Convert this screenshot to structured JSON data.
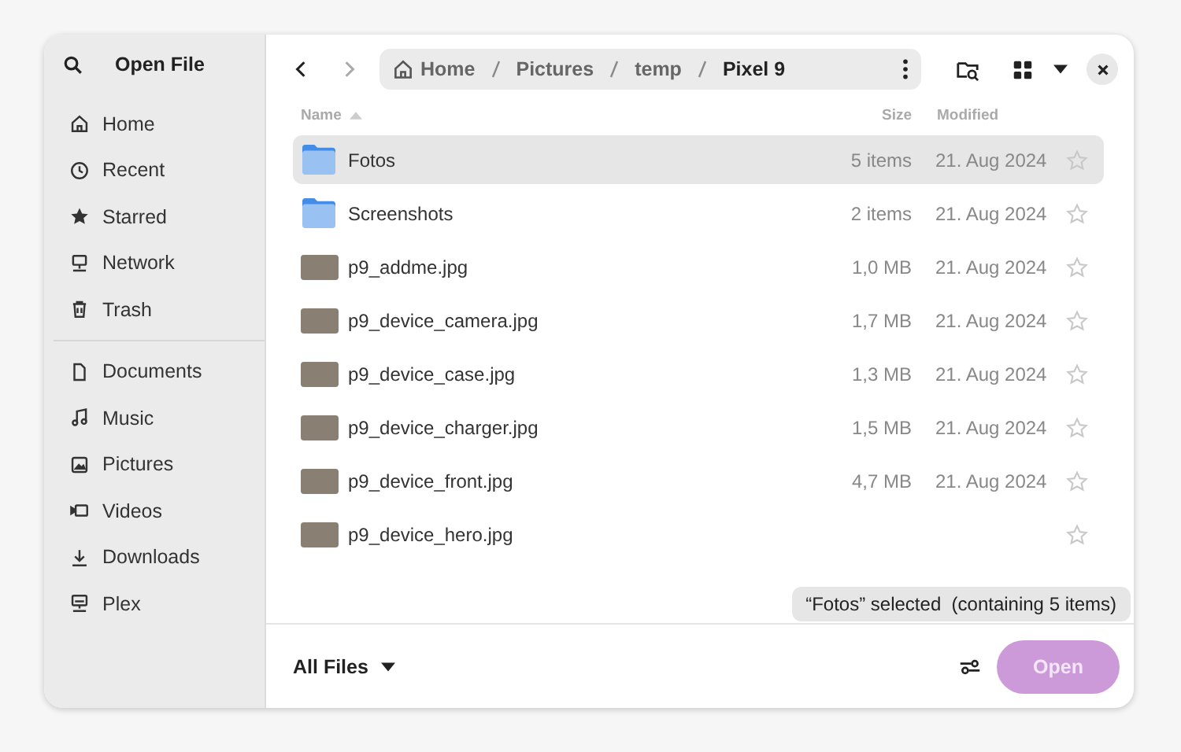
{
  "window": {
    "title": "Open File"
  },
  "sidebar": {
    "places": [
      {
        "label": "Home"
      },
      {
        "label": "Recent"
      },
      {
        "label": "Starred"
      },
      {
        "label": "Network"
      },
      {
        "label": "Trash"
      }
    ],
    "bookmarks": [
      {
        "label": "Documents"
      },
      {
        "label": "Music"
      },
      {
        "label": "Pictures"
      },
      {
        "label": "Videos"
      },
      {
        "label": "Downloads"
      },
      {
        "label": "Plex"
      }
    ]
  },
  "path": [
    {
      "label": "Home",
      "current": false
    },
    {
      "label": "Pictures",
      "current": false
    },
    {
      "label": "temp",
      "current": false
    },
    {
      "label": "Pixel 9",
      "current": true
    }
  ],
  "columns": [
    {
      "label": "Name",
      "sorted": true
    },
    {
      "label": "Size",
      "sorted": false
    },
    {
      "label": "Modified",
      "sorted": false
    }
  ],
  "rows": [
    {
      "kind": "folder",
      "name": "Fotos",
      "size": "5 items",
      "modified": "21. Aug 2024",
      "starred": false,
      "selected": true
    },
    {
      "kind": "folder",
      "name": "Screenshots",
      "size": "2 items",
      "modified": "21. Aug 2024",
      "starred": false,
      "selected": false
    },
    {
      "kind": "image",
      "name": "p9_addme.jpg",
      "size": "1,0 MB",
      "modified": "21. Aug 2024",
      "starred": false,
      "selected": false
    },
    {
      "kind": "image",
      "name": "p9_device_camera.jpg",
      "size": "1,7 MB",
      "modified": "21. Aug 2024",
      "starred": false,
      "selected": false
    },
    {
      "kind": "image",
      "name": "p9_device_case.jpg",
      "size": "1,3 MB",
      "modified": "21. Aug 2024",
      "starred": false,
      "selected": false
    },
    {
      "kind": "image",
      "name": "p9_device_charger.jpg",
      "size": "1,5 MB",
      "modified": "21. Aug 2024",
      "starred": false,
      "selected": false
    },
    {
      "kind": "image",
      "name": "p9_device_front.jpg",
      "size": "4,7 MB",
      "modified": "21. Aug 2024",
      "starred": false,
      "selected": false
    },
    {
      "kind": "image",
      "name": "p9_device_hero.jpg",
      "starred": false,
      "selected": false
    }
  ],
  "toast": "“Fotos” selected  (containing 5 items)",
  "footer": {
    "filter": "All Files",
    "open_button": "Open"
  }
}
